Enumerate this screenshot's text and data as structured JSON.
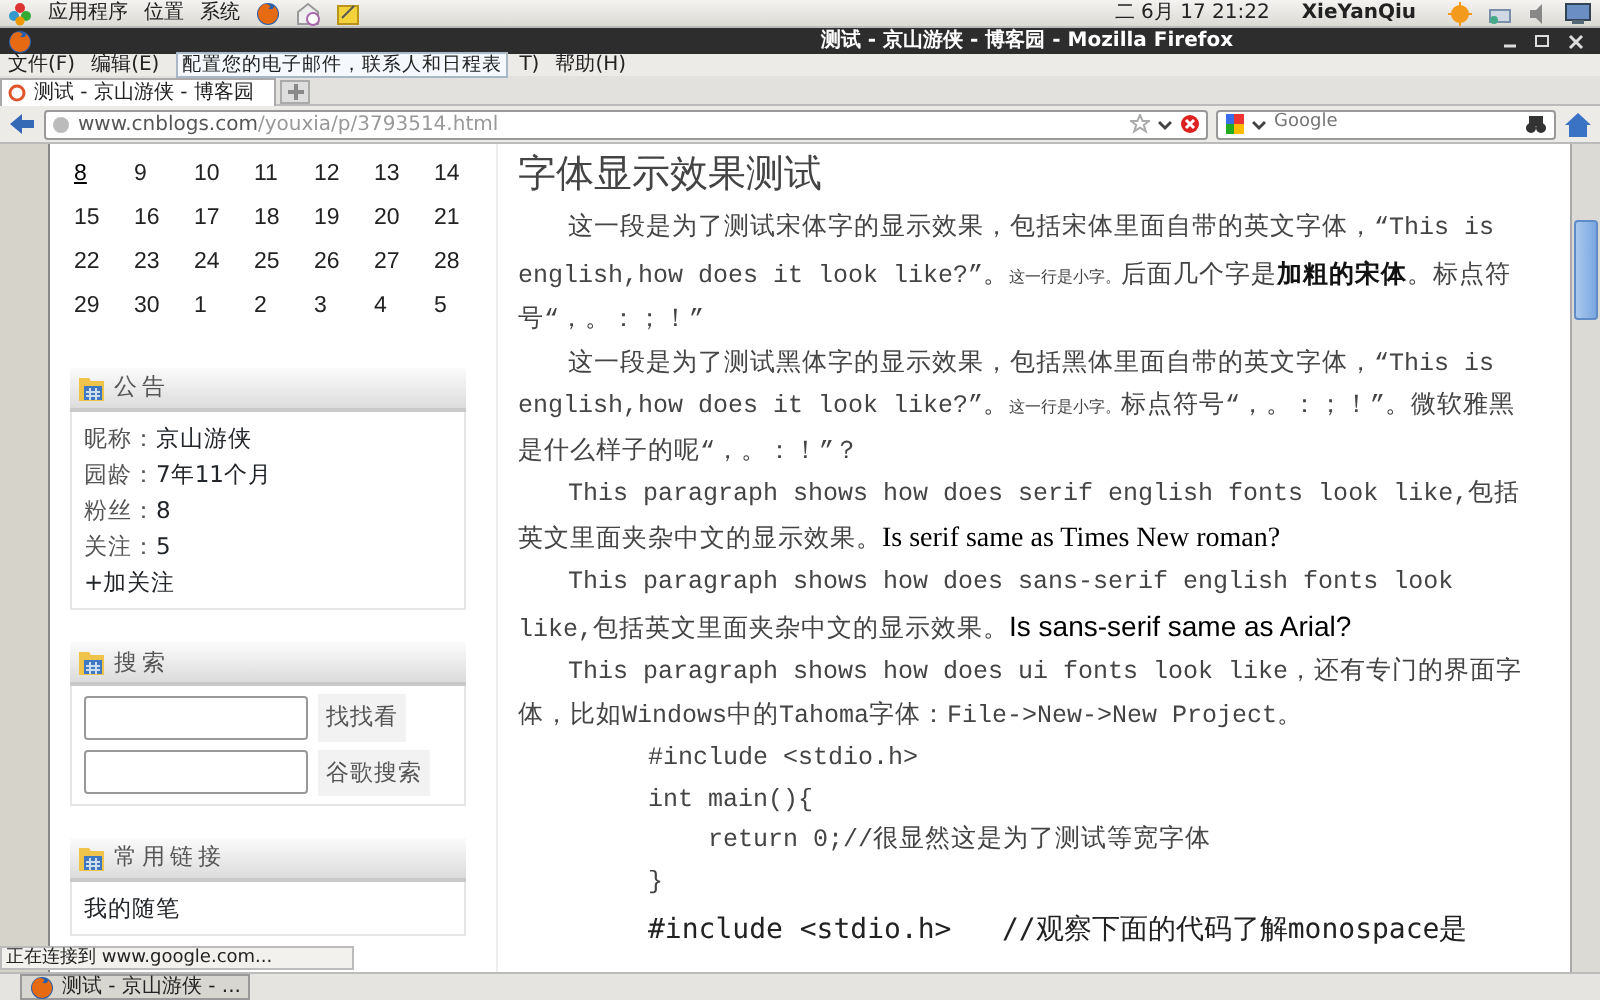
{
  "top_panel": {
    "menus": [
      "应用程序",
      "位置",
      "系统"
    ],
    "clock": "二 6月 17 21:22",
    "user": "XieYanQiu"
  },
  "window": {
    "title": "测试 - 京山游侠 - 博客园 - Mozilla Firefox"
  },
  "menu_bar": [
    "文件(F)",
    "编辑(E)",
    "T)",
    "帮助(H)"
  ],
  "tooltip": "配置您的电子邮件，联系人和日程表",
  "tabs": [
    {
      "label": "测试 - 京山游侠 - 博客园",
      "selected": true
    }
  ],
  "address_bar": {
    "host": "www.cnblogs.com",
    "path": "/youxia/p/3793514.html"
  },
  "search_bar": {
    "placeholder": "Google"
  },
  "calendar": {
    "weeks": [
      [
        {
          "day": "8",
          "link": true
        },
        {
          "day": "9",
          "link": false
        },
        {
          "day": "10",
          "link": false
        },
        {
          "day": "11",
          "link": false
        },
        {
          "day": "12",
          "link": false
        },
        {
          "day": "13",
          "link": false
        },
        {
          "day": "14",
          "link": false
        }
      ],
      [
        {
          "day": "15",
          "link": false
        },
        {
          "day": "16",
          "link": false
        },
        {
          "day": "17",
          "link": false
        },
        {
          "day": "18",
          "link": false
        },
        {
          "day": "19",
          "link": false
        },
        {
          "day": "20",
          "link": false
        },
        {
          "day": "21",
          "link": false
        }
      ],
      [
        {
          "day": "22",
          "link": false
        },
        {
          "day": "23",
          "link": false
        },
        {
          "day": "24",
          "link": false
        },
        {
          "day": "25",
          "link": false
        },
        {
          "day": "26",
          "link": false
        },
        {
          "day": "27",
          "link": false
        },
        {
          "day": "28",
          "link": false
        }
      ],
      [
        {
          "day": "29",
          "link": false
        },
        {
          "day": "30",
          "link": false
        },
        {
          "day": "1",
          "link": false
        },
        {
          "day": "2",
          "link": false
        },
        {
          "day": "3",
          "link": false
        },
        {
          "day": "4",
          "link": false
        },
        {
          "day": "5",
          "link": false
        }
      ]
    ]
  },
  "notice": {
    "title": "公告",
    "rows": [
      {
        "label": "昵称：",
        "value": "京山游侠"
      },
      {
        "label": "园龄：",
        "value": "7年11个月"
      },
      {
        "label": "粉丝：",
        "value": "8"
      },
      {
        "label": "关注：",
        "value": "5"
      }
    ],
    "follow_link": "+加关注"
  },
  "search_panel": {
    "title": "搜索",
    "buttons": [
      "找找看",
      "谷歌搜索"
    ]
  },
  "links_panel": {
    "title": "常用链接",
    "items": [
      "我的随笔"
    ]
  },
  "article": {
    "title": "字体显示效果测试",
    "paragraphs": [
      [
        {
          "kind": "plain",
          "text": "这一段是为了测试宋体字的显示效果，包括宋体里面自带的英文字体，“This is english,how does it look like?”。"
        },
        {
          "kind": "small",
          "text": "这一行是小字。"
        },
        {
          "kind": "plain",
          "text": "后面几个字是"
        },
        {
          "kind": "bold",
          "text": "加粗的宋体"
        },
        {
          "kind": "plain",
          "text": "。标点符号“，。：；！”"
        }
      ],
      [
        {
          "kind": "plain",
          "text": "这一段是为了测试黑体字的显示效果，包括黑体里面自带的英文字体，“This is english,how does it look like?”。"
        },
        {
          "kind": "small",
          "text": "这一行是小字。"
        },
        {
          "kind": "plain",
          "text": "标点符号“，。：；！”。微软雅黑是什么样子的呢“，。：！”？"
        }
      ],
      [
        {
          "kind": "plain",
          "text": "This paragraph shows how does serif english fonts look like,包括英文里面夹杂中文的显示效果。"
        },
        {
          "kind": "serif",
          "text": "Is serif same as Times New roman?"
        }
      ],
      [
        {
          "kind": "plain",
          "text": "This paragraph shows how does sans-serif english fonts look like,包括英文里面夹杂中文的显示效果。"
        },
        {
          "kind": "sans",
          "text": "Is sans-serif same as Arial?"
        }
      ],
      [
        {
          "kind": "plain",
          "text": "This paragraph shows how does ui fonts look like，还有专门的界面字体，比如Windows中的Tahoma字体：File->New->New Project。"
        }
      ]
    ],
    "code": [
      "#include <stdio.h>",
      "int main(){",
      "    return 0;//很显然这是为了测试等宽字体",
      "}"
    ],
    "code_bold": "#include <stdio.h>   //观察下面的代码了解monospace是"
  },
  "status_text": "正在连接到 www.google.com...",
  "taskbar": {
    "items": [
      {
        "label": "测试 - 京山游侠 - ...",
        "selected": false
      }
    ]
  }
}
